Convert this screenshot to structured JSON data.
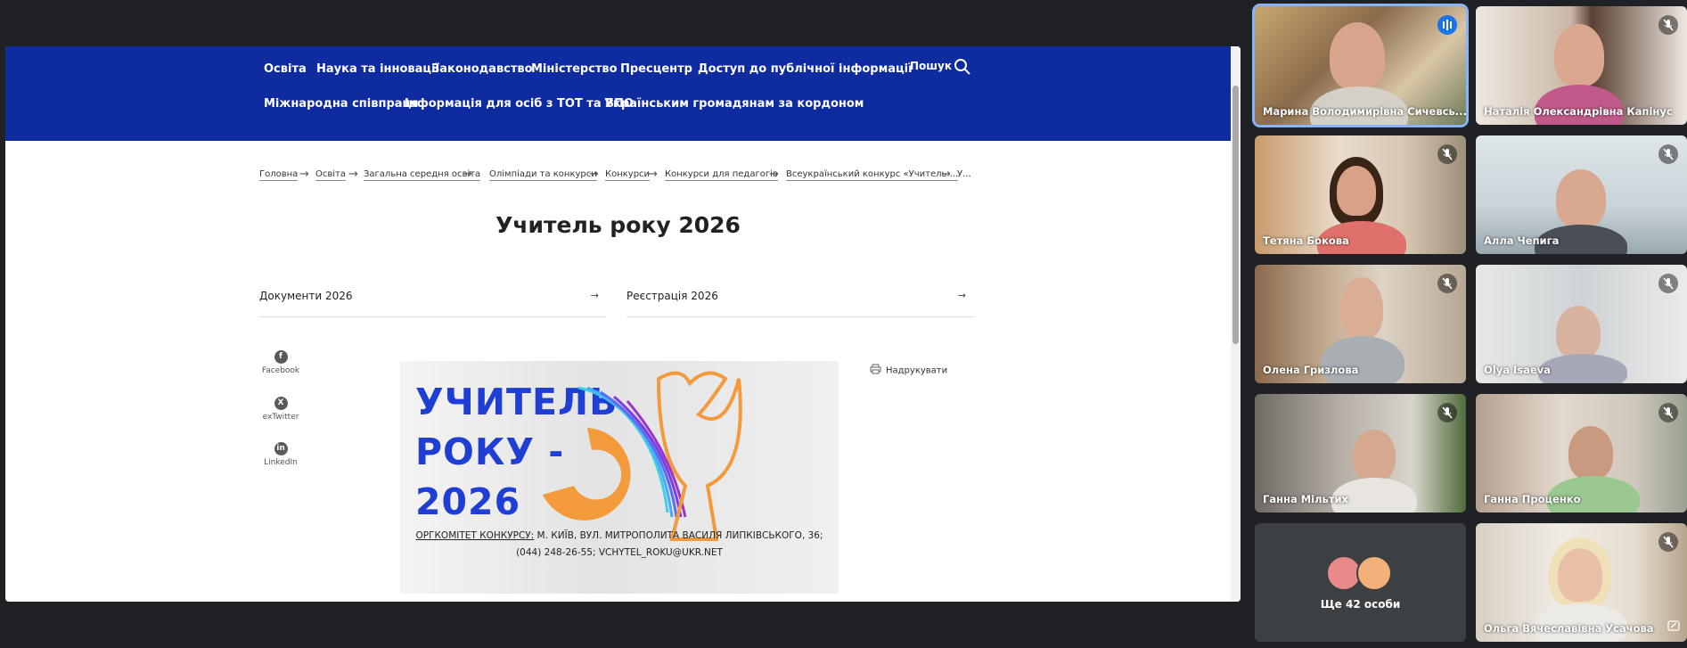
{
  "shared_screen": {
    "nav_row1": [
      "Освіта",
      "Наука та інновації",
      "Законодавство",
      "Міністерство",
      "Пресцентр",
      "Доступ до публічної інформації"
    ],
    "nav_row2": [
      "Міжнародна співпраця",
      "Інформація для осіб з ТОТ та ВПО",
      "Українським громадянам за кордоном"
    ],
    "search_label": "Пошук",
    "breadcrumbs": [
      "Головна",
      "Освіта",
      "Загальна середня освіта",
      "Олімпіади та конкурси",
      "Конкурси",
      "Конкурси для педагогів",
      "Всеукраїнський конкурс «Учитель ...",
      "У..."
    ],
    "title": "Учитель року 2026",
    "links": [
      "Документи 2026",
      "Реєстрація 2026"
    ],
    "share": [
      "Facebook",
      "exTwitter",
      "LinkedIn"
    ],
    "print_label": "Надрукувати",
    "banner": {
      "line1": "УЧИТЕЛЬ",
      "line2": "РОКУ -",
      "line3": "2026",
      "org_label": "ОРГКОМІТЕТ КОНКУРСУ:",
      "org_address": " М. КИЇВ, ВУЛ. МИТРОПОЛИТА ВАСИЛЯ ЛИПКІВСЬКОГО, 36;",
      "org_contacts": "(044) 248-26-55; VCHYTEL_ROKU@UKR.NET"
    }
  },
  "participants": [
    {
      "name": "Марина Володимирівна Сичевсь..."
    },
    {
      "name": "Наталія Олександрівна Капінус"
    },
    {
      "name": "Тетяна Бокова"
    },
    {
      "name": "Алла Чепига"
    },
    {
      "name": "Олена Гризлова"
    },
    {
      "name": "Olya Isaeva"
    },
    {
      "name": "Ганна Мільтих"
    },
    {
      "name": "Ганна Проценко"
    },
    {
      "name": "Ольга Вячеславівна Усачова"
    }
  ],
  "more_participants": "Ще 42 особи",
  "colors": {
    "nav_bg": "#0f2ba0",
    "app_bg": "#202124",
    "active_speaker": "#8ab4f8"
  }
}
